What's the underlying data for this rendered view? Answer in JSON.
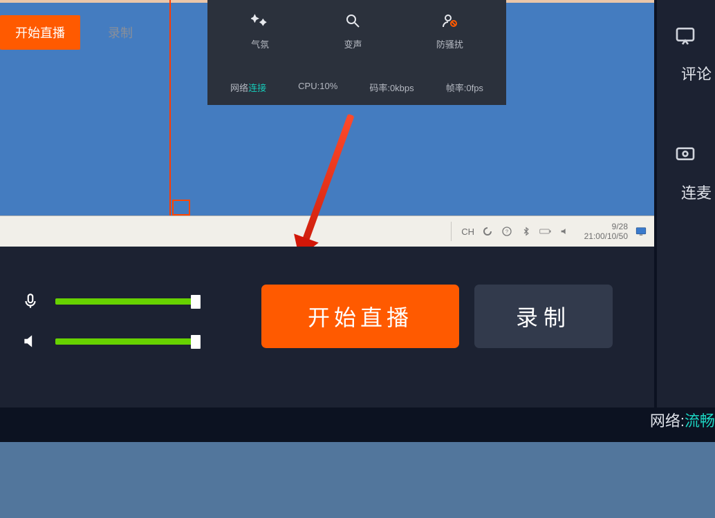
{
  "top_buttons": {
    "primary": "开始直播",
    "ghost": "录制"
  },
  "status_panel": {
    "items": [
      {
        "icon": "mic-boost-icon",
        "label": "气氛"
      },
      {
        "icon": "magnifier-icon",
        "label": "变声"
      },
      {
        "icon": "user-slash-icon",
        "label": "防骚扰"
      }
    ],
    "bottom": {
      "net_label": "网络",
      "net_value": "连接",
      "cpu": "CPU:10%",
      "bitrate": "码率:0kbps",
      "fps": "帧率:0fps"
    }
  },
  "taskbar": {
    "lang": "CH",
    "date": "9/28",
    "time": "21:00/10/50"
  },
  "audio": {
    "mic_level": 100,
    "spk_level": 100
  },
  "big_buttons": {
    "primary": "开始直播",
    "secondary": "录制"
  },
  "right_sidebar": {
    "label1": "评论",
    "label2": "连麦"
  },
  "net_status": {
    "label": "网络:",
    "value": "流畅"
  }
}
